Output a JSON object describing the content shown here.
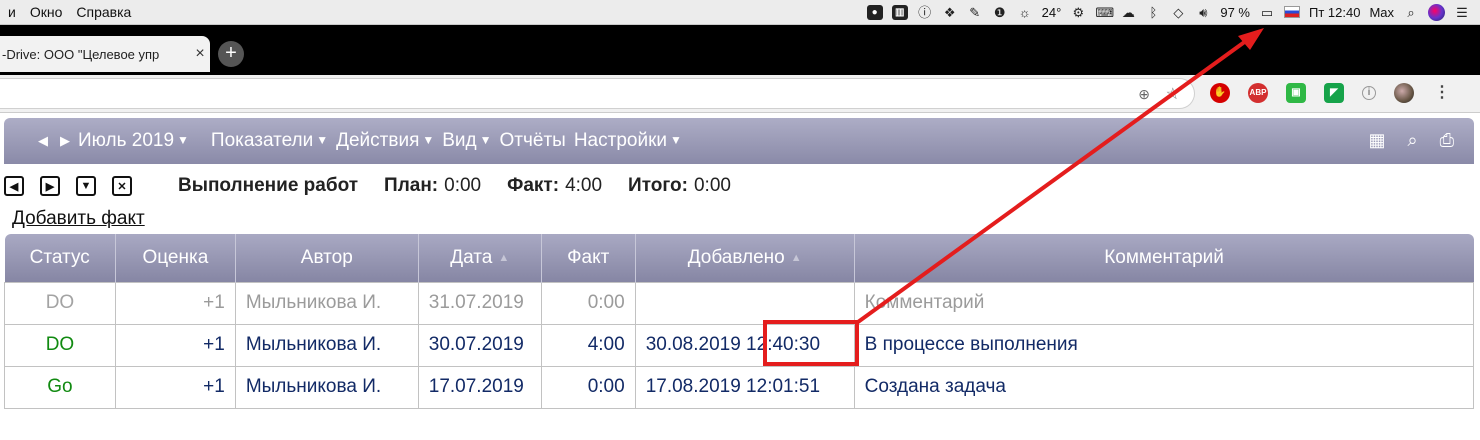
{
  "menubar": {
    "items": [
      "и",
      "Окно",
      "Справка"
    ],
    "weather": "24°",
    "battery": "97 %",
    "clock": "Пт 12:40",
    "user": "Max"
  },
  "browser": {
    "tab_title": "-Drive: ООО \"Целевое упр",
    "tab_close": "×",
    "new_tab": "+"
  },
  "toolbar": {
    "prev": "◀",
    "next": "▶",
    "period": "Июль 2019",
    "menu": [
      "Показатели",
      "Действия",
      "Вид",
      "Отчёты",
      "Настройки"
    ]
  },
  "work": {
    "title": "Выполнение работ",
    "plan_label": "План:",
    "plan_value": "0:00",
    "fact_label": "Факт:",
    "fact_value": "4:00",
    "total_label": "Итого:",
    "total_value": "0:00",
    "add_link": "Добавить факт"
  },
  "table": {
    "headers": [
      "Статус",
      "Оценка",
      "Автор",
      "Дата",
      "Факт",
      "Добавлено",
      "Комментарий"
    ],
    "rows": [
      {
        "status": "DO",
        "score": "+1",
        "author": "Мыльникова И.",
        "date": "31.07.2019",
        "fact": "0:00",
        "added": "",
        "comment": "Комментарий"
      },
      {
        "status": "DO",
        "score": "+1",
        "author": "Мыльникова И.",
        "date": "30.07.2019",
        "fact": "4:00",
        "added": "30.08.2019 12:40:30",
        "comment": "В процессе выполнения"
      },
      {
        "status": "Go",
        "score": "+1",
        "author": "Мыльникова И.",
        "date": "17.07.2019",
        "fact": "0:00",
        "added": "17.08.2019 12:01:51",
        "comment": "Создана задача"
      }
    ]
  },
  "colors": {
    "annotation": "#e41d1d",
    "toolbar": "#9a9ab6",
    "status_green": "#118a11"
  }
}
